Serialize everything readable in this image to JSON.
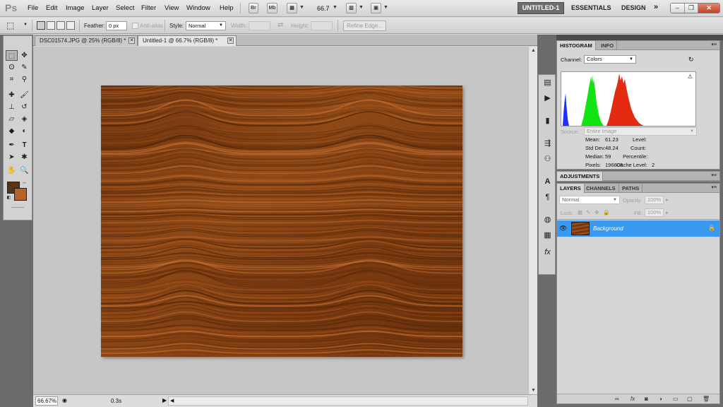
{
  "app": {
    "logo": "Ps"
  },
  "menu": [
    "File",
    "Edit",
    "Image",
    "Layer",
    "Select",
    "Filter",
    "View",
    "Window",
    "Help"
  ],
  "menubar_buttons": {
    "bridge": "Br",
    "minibridge": "Mb",
    "zoom": "66.7"
  },
  "workspaces": {
    "active": "UNTITLED-1",
    "essentials": "ESSENTIALS",
    "design": "DESIGN",
    "more": "»"
  },
  "window_controls": {
    "minimize": "–",
    "restore": "❐",
    "close": "✕"
  },
  "options": {
    "feather_label": "Feather:",
    "feather_value": "0 px",
    "antialias_label": "Anti-alias",
    "style_label": "Style:",
    "style_value": "Normal",
    "width_label": "Width:",
    "height_label": "Height:",
    "refine_edge": "Refine Edge..."
  },
  "tabs": [
    {
      "label": "DSC01574.JPG @ 25% (RGB/8) *"
    },
    {
      "label": "Untitled-1 @ 66.7% (RGB/8) *"
    }
  ],
  "colors": {
    "foreground": "#5c3215",
    "background": "#b8622a",
    "layer_selected": "#3998f0"
  },
  "status": {
    "zoom": "66.67%",
    "info": "0.3s"
  },
  "histogram": {
    "tabs": [
      "HISTOGRAM",
      "INFO"
    ],
    "channel_label": "Channel:",
    "channel_value": "Colors",
    "source_label": "Source:",
    "source_value": "Entire Image",
    "stats_left": [
      {
        "label": "Mean:",
        "value": "61.23"
      },
      {
        "label": "Std Dev:",
        "value": "48.24"
      },
      {
        "label": "Median:",
        "value": "59"
      },
      {
        "label": "Pixels:",
        "value": "196608"
      }
    ],
    "stats_right": [
      {
        "label": "Level:",
        "value": ""
      },
      {
        "label": "Count:",
        "value": ""
      },
      {
        "label": "Percentile:",
        "value": ""
      },
      {
        "label": "Cache Level:",
        "value": "2"
      }
    ]
  },
  "adjustments": {
    "tab": "ADJUSTMENTS"
  },
  "layers": {
    "tabs": [
      "LAYERS",
      "CHANNELS",
      "PATHS"
    ],
    "blend_mode": "Normal",
    "opacity_label": "Opacity:",
    "opacity_value": "100%",
    "lock_label": "Lock:",
    "fill_label": "Fill:",
    "fill_value": "100%",
    "items": [
      {
        "name": "Background"
      }
    ]
  }
}
